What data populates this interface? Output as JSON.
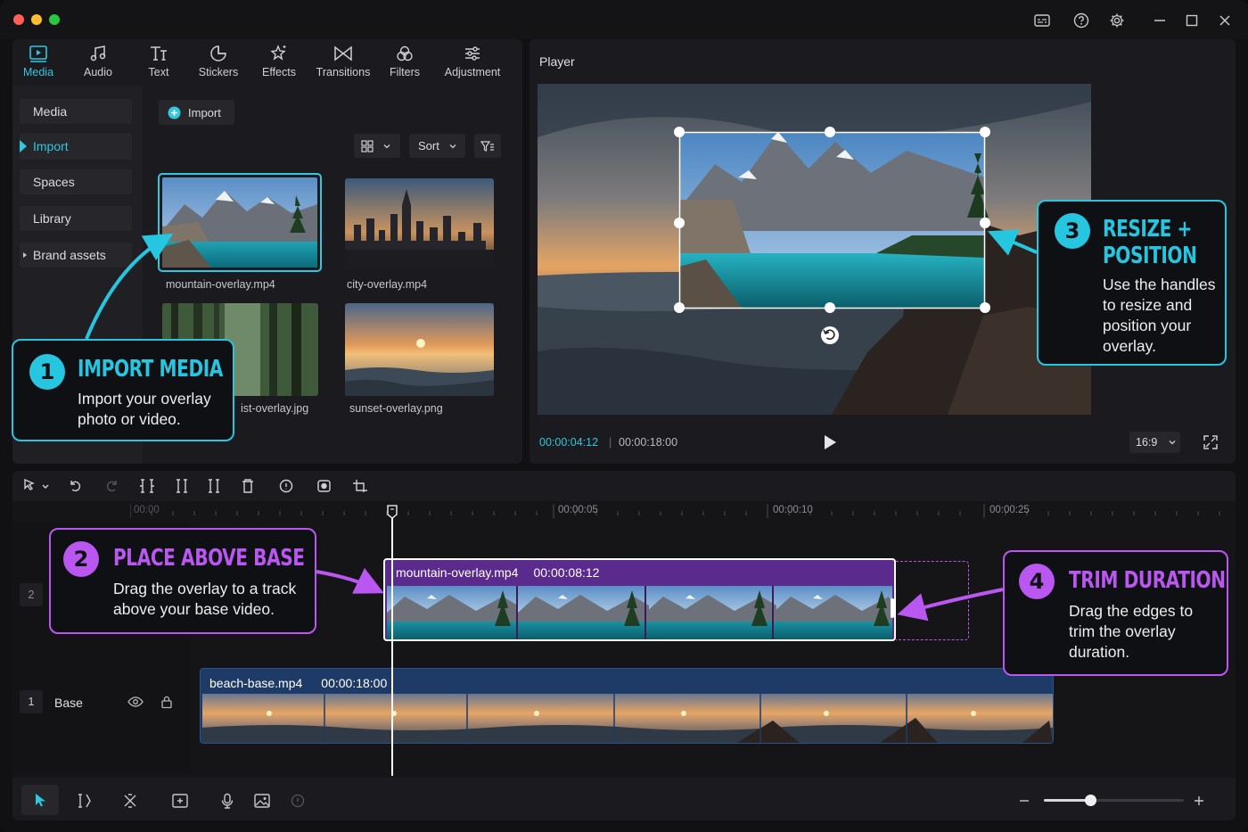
{
  "window": {
    "controls": [
      "help-icon",
      "settings-icon",
      "minimize-icon",
      "maximize-icon",
      "close-icon"
    ]
  },
  "tabs": [
    {
      "label": "Media",
      "icon": "media-icon",
      "active": true
    },
    {
      "label": "Audio",
      "icon": "music-note-icon"
    },
    {
      "label": "Text",
      "icon": "text-icon"
    },
    {
      "label": "Stickers",
      "icon": "sticker-icon"
    },
    {
      "label": "Effects",
      "icon": "star-effects-icon"
    },
    {
      "label": "Transitions",
      "icon": "bowtie-transition-icon"
    },
    {
      "label": "Filters",
      "icon": "filter-circles-icon"
    },
    {
      "label": "Adjustment",
      "icon": "sliders-icon"
    }
  ],
  "sidebar": {
    "items": [
      {
        "label": "Media"
      },
      {
        "label": "Import",
        "active": true
      },
      {
        "label": "Spaces"
      },
      {
        "label": "Library"
      },
      {
        "label": "Brand assets"
      }
    ]
  },
  "media": {
    "import_label": "Import",
    "sort_label": "Sort",
    "thumbs": [
      {
        "label": "mountain-overlay.mp4",
        "selected": true
      },
      {
        "label": "city-overlay.mp4"
      },
      {
        "label": "ist-overlay.jpg"
      },
      {
        "label": "sunset-overlay.png"
      }
    ]
  },
  "player": {
    "title": "Player",
    "current_time": "00:00:04:12",
    "total_time": "00:00:18:00",
    "aspect": "16:9"
  },
  "timeline": {
    "ruler": [
      "00:00",
      "00:00:05",
      "00:00:10",
      "00:00:25"
    ],
    "track2_num": "2",
    "track1_num": "1",
    "track1_name": "Base",
    "overlay_clip": {
      "name": "mountain-overlay.mp4",
      "duration": "00:00:08:12"
    },
    "base_clip": {
      "name": "beach-base.mp4",
      "duration": "00:00:18:00"
    },
    "zoom_level": 0.55
  },
  "callouts": [
    {
      "num": "1",
      "title": "IMPORT MEDIA",
      "desc": "Import your overlay photo or video.",
      "color": "#27c6e0"
    },
    {
      "num": "2",
      "title": "PLACE ABOVE BASE",
      "desc": "Drag the overlay to a track above your base video.",
      "color": "#b957f0"
    },
    {
      "num": "3",
      "title": "RESIZE + POSITION",
      "desc": "Use the handles to resize and position your overlay.",
      "color": "#27c6e0"
    },
    {
      "num": "4",
      "title": "TRIM DURATION",
      "desc": "Drag the edges to trim the overlay duration.",
      "color": "#b957f0"
    }
  ],
  "colors": {
    "accent": "#2fc8de",
    "purple": "#b957f0",
    "base_track": "#1e3a66",
    "overlay_track": "#5a2a8c"
  }
}
